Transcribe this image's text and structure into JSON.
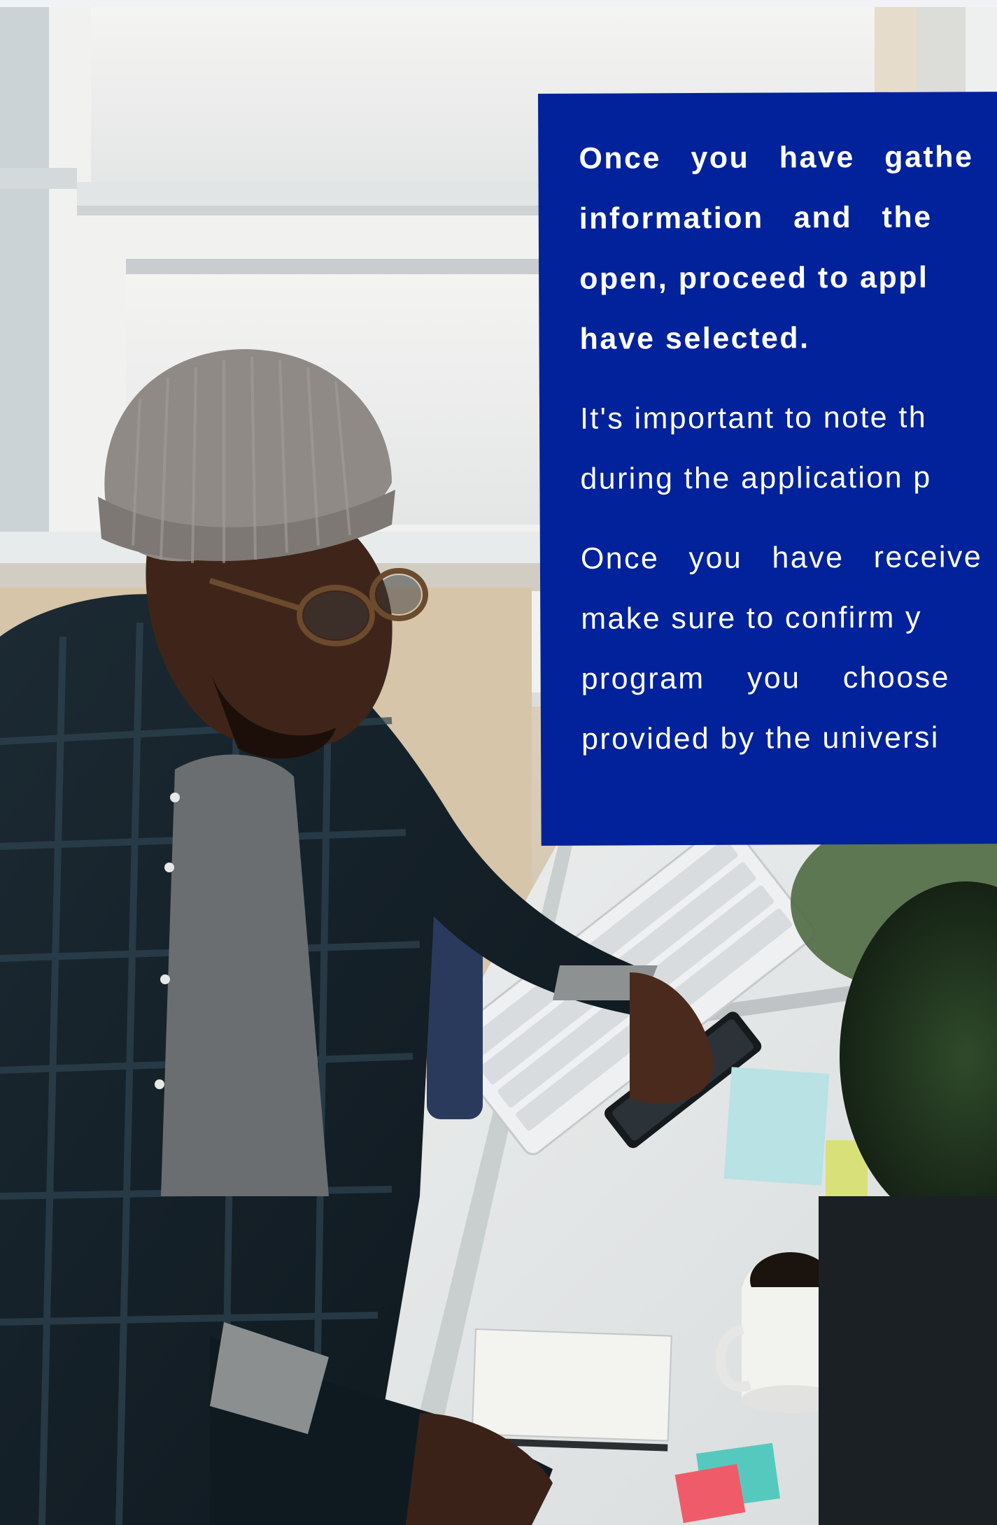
{
  "photo": {
    "icon": "photo-man-at-desk"
  },
  "card": {
    "background_color": "#01229a",
    "text_color": "#ffffff",
    "paragraph1": {
      "lines": [
        "Once you have gathe",
        "information and the",
        "open, proceed to appl",
        "have selected."
      ]
    },
    "paragraph2": {
      "lines": [
        "It's important to note th",
        "during the application p"
      ]
    },
    "paragraph3": {
      "lines": [
        "Once you have receive",
        "make sure to confirm y",
        "program you choose",
        "provided by the universi"
      ]
    }
  }
}
